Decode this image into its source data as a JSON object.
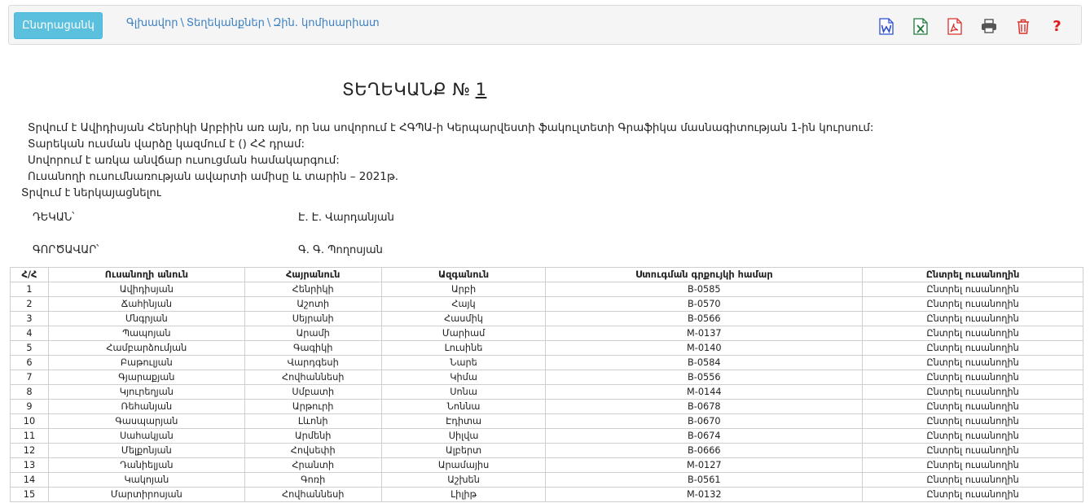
{
  "toolbar": {
    "select_button": "Ընտրացանկ",
    "breadcrumb": [
      "Գլխավոր",
      "Տեղեկանքներ",
      "Զին. կոմիսարիատ"
    ],
    "breadcrumb_sep": "\\",
    "icons": [
      "word-icon",
      "excel-icon",
      "pdf-icon",
      "print-icon",
      "trash-icon",
      "help-icon"
    ],
    "help_glyph": "?"
  },
  "document": {
    "title": "ՏԵՂԵԿԱՆՔ №",
    "number": "1",
    "lines": [
      "Տրվում է Ավիդիսյան Հենրիկի Արբիին առ այն, որ նա սովորում է ՀԳՊԱ-ի Կերպարվեստի ֆակուլտետի Գրաֆիկա մասնագիտության 1-ին կուրսում:",
      "Տարեկան ուսման վարձը կազմում է () ՀՀ դրամ:",
      "Սովորում է առկա անվճար ուսուցման համակարգում:",
      "Ուսանողի ուսումնառության ավարտի ամիսը և տարին – 2021թ.",
      "Տրվում  է ներկայացնելու"
    ],
    "dean_label": "ԴԵԿԱՆ՝",
    "dean_name": "Է. Է. Վարդանյան",
    "manager_label": "ԳՈՐԾԱՎԱՐ՝",
    "manager_name": "Գ. Գ. Պողոսյան"
  },
  "table": {
    "headers": [
      "Հ/Հ",
      "Ուսանողի անուն",
      "Հայրանուն",
      "Ազգանուն",
      "Ստուգման գրքույկի համար",
      "Ընտրել ուսանողին"
    ],
    "rows": [
      [
        "1",
        "Ավիդիսյան",
        "Հենրիկի",
        "Արբի",
        "B-0585",
        "Ընտրել ուսանողին"
      ],
      [
        "2",
        "Ճահինյան",
        "Աշոտի",
        "Հայկ",
        "B-0570",
        "Ընտրել ուսանողին"
      ],
      [
        "3",
        "Մնգրյան",
        "Սեյրանի",
        "Հասմիկ",
        "B-0566",
        "Ընտրել ուսանողին"
      ],
      [
        "4",
        "Պապոյան",
        "Արամի",
        "Մարիամ",
        "M-0137",
        "Ընտրել ուսանողին"
      ],
      [
        "5",
        "Համբարձումյան",
        "Գագիկի",
        "Լուսինե",
        "M-0140",
        "Ընտրել ուսանողին"
      ],
      [
        "6",
        "Բաթուլյան",
        "Վարդգեսի",
        "Նարե",
        "B-0584",
        "Ընտրել ուսանողին"
      ],
      [
        "7",
        "Գյարաքյան",
        "Հովհաննեսի",
        "Կիմա",
        "B-0556",
        "Ընտրել ուսանողին"
      ],
      [
        "8",
        "Կյուրեղյան",
        "Սմբատի",
        "Սոնա",
        "M-0144",
        "Ընտրել ուսանողին"
      ],
      [
        "9",
        "Ռեհանյան",
        "Արթուրի",
        "Նոննա",
        "B-0678",
        "Ընտրել ուսանողին"
      ],
      [
        "10",
        "Գասպարյան",
        "Լևոնի",
        "Էդիտա",
        "B-0670",
        "Ընտրել ուսանողին"
      ],
      [
        "11",
        "Սահակյան",
        "Արմենի",
        "Սիլվա",
        "B-0674",
        "Ընտրել ուսանողին"
      ],
      [
        "12",
        "Մելքոնյան",
        "Հովսեփի",
        "Ալբերտ",
        "B-0666",
        "Ընտրել ուսանողին"
      ],
      [
        "13",
        "Դանիելյան",
        "Հրանտի",
        "Արամայիս",
        "M-0127",
        "Ընտրել ուսանողին"
      ],
      [
        "14",
        "Կակոյան",
        "Գոռի",
        "Աշխեն",
        "B-0561",
        "Ընտրել ուսանողին"
      ],
      [
        "15",
        "Մարտիրոսյան",
        "Հովհաննեսի",
        "Լիլիթ",
        "M-0132",
        "Ընտրել ուսանողին"
      ]
    ]
  },
  "colors": {
    "accent": "#5bc0de",
    "link": "#3a7fc1",
    "word": "#2b4fcf",
    "excel": "#217a3c",
    "pdf": "#d9312b",
    "print": "#555555",
    "trash": "#d9312b",
    "help": "#e0191d"
  }
}
